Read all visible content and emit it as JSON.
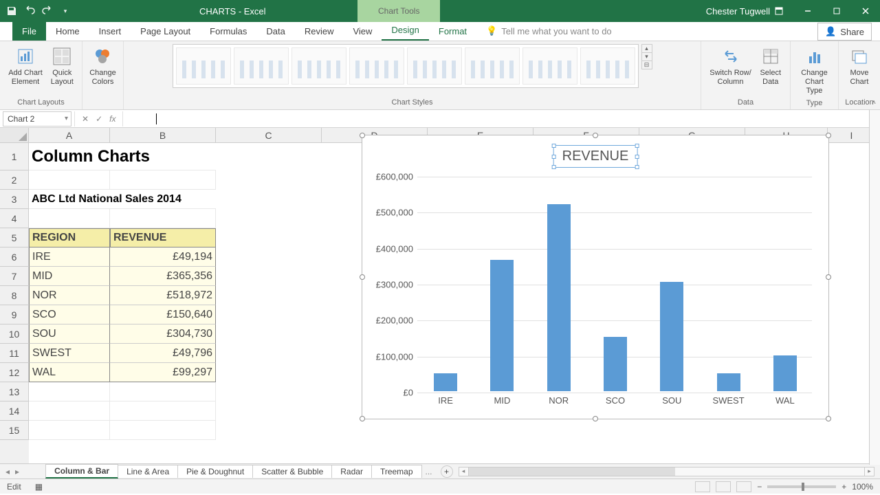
{
  "titlebar": {
    "title": "CHARTS - Excel",
    "tool_context": "Chart Tools",
    "user": "Chester Tugwell"
  },
  "tabs": {
    "items": [
      "File",
      "Home",
      "Insert",
      "Page Layout",
      "Formulas",
      "Data",
      "Review",
      "View",
      "Design",
      "Format"
    ],
    "active": "Design",
    "tellme": "Tell me what you want to do",
    "share": "Share"
  },
  "ribbon": {
    "chart_layouts": {
      "label": "Chart Layouts",
      "add_el": "Add Chart\nElement",
      "quick": "Quick\nLayout"
    },
    "change_colors": "Change\nColors",
    "chart_styles_label": "Chart Styles",
    "data": {
      "label": "Data",
      "switch": "Switch Row/\nColumn",
      "select": "Select\nData"
    },
    "type": {
      "label": "Type",
      "change": "Change\nChart Type"
    },
    "location": {
      "label": "Location",
      "move": "Move\nChart"
    }
  },
  "namebox": "Chart 2",
  "formula": "",
  "columns": [
    "A",
    "B",
    "C",
    "D",
    "E",
    "F",
    "G",
    "H",
    "I"
  ],
  "rows_visible": 15,
  "sheet": {
    "title": "Column  Charts",
    "subtitle": "ABC Ltd National Sales 2014",
    "headers": {
      "region": "REGION",
      "revenue": "REVENUE"
    },
    "table": [
      {
        "region": "IRE",
        "revenue": "£49,194"
      },
      {
        "region": "MID",
        "revenue": "£365,356"
      },
      {
        "region": "NOR",
        "revenue": "£518,972"
      },
      {
        "region": "SCO",
        "revenue": "£150,640"
      },
      {
        "region": "SOU",
        "revenue": "£304,730"
      },
      {
        "region": "SWEST",
        "revenue": "£49,796"
      },
      {
        "region": "WAL",
        "revenue": "£99,297"
      }
    ]
  },
  "chart_data": {
    "type": "bar",
    "title": "REVENUE",
    "categories": [
      "IRE",
      "MID",
      "NOR",
      "SCO",
      "SOU",
      "SWEST",
      "WAL"
    ],
    "values": [
      49194,
      365356,
      518972,
      150640,
      304730,
      49796,
      99297
    ],
    "ylabels": [
      "£0",
      "£100,000",
      "£200,000",
      "£300,000",
      "£400,000",
      "£500,000",
      "£600,000"
    ],
    "ylim": [
      0,
      600000
    ],
    "xlabel": "",
    "ylabel": ""
  },
  "sheet_tabs": {
    "items": [
      "Column & Bar",
      "Line & Area",
      "Pie & Doughnut",
      "Scatter & Bubble",
      "Radar",
      "Treemap"
    ],
    "active": "Column & Bar",
    "more": "..."
  },
  "status": {
    "mode": "Edit",
    "zoom": "100%"
  }
}
